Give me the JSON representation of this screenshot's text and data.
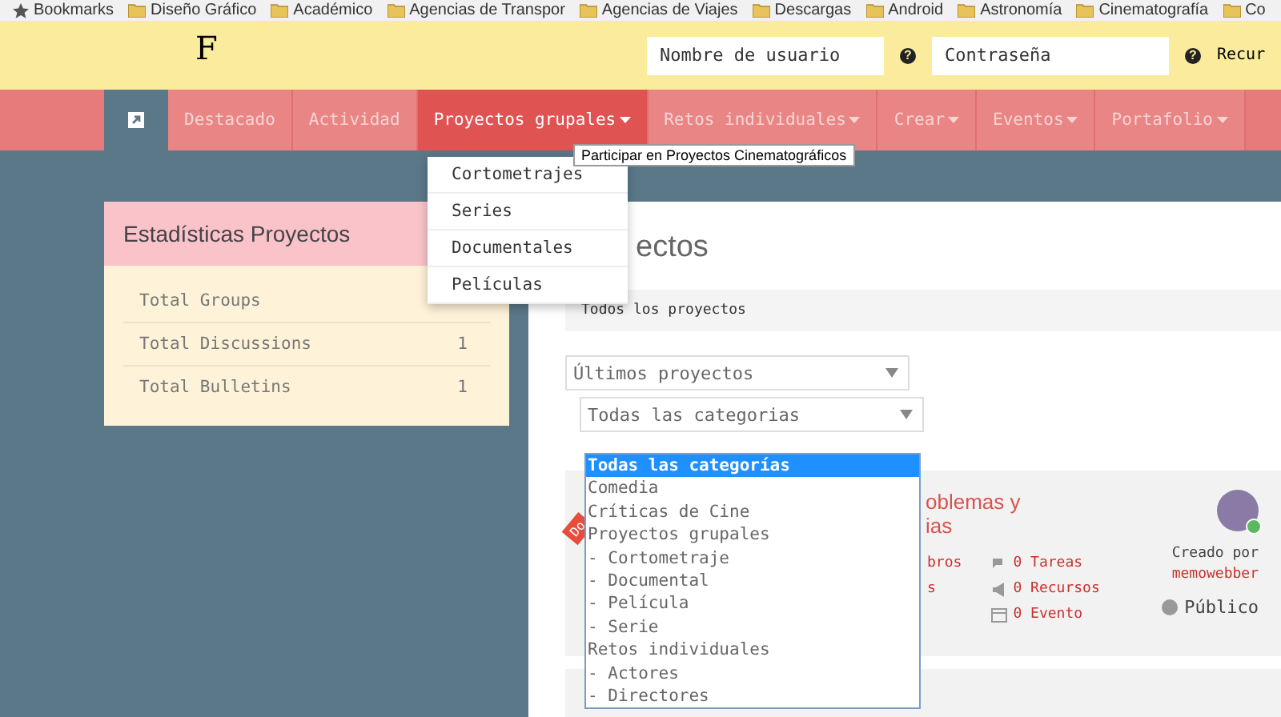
{
  "bookmarks_bar": {
    "items": [
      {
        "kind": "star",
        "label": "Bookmarks"
      },
      {
        "kind": "folder",
        "label": "Diseño Gráfico"
      },
      {
        "kind": "folder",
        "label": "Académico"
      },
      {
        "kind": "folder",
        "label": "Agencias de Transpor"
      },
      {
        "kind": "folder",
        "label": "Agencias de Viajes"
      },
      {
        "kind": "folder",
        "label": "Descargas"
      },
      {
        "kind": "folder",
        "label": "Android"
      },
      {
        "kind": "folder",
        "label": "Astronomía"
      },
      {
        "kind": "folder",
        "label": "Cinematografía"
      },
      {
        "kind": "folder",
        "label": "Co"
      }
    ]
  },
  "header": {
    "logo": "F",
    "username": {
      "placeholder": "Nombre de usuario",
      "help": "?"
    },
    "password": {
      "placeholder": "Contraseña",
      "help": "?"
    },
    "link": "Recur"
  },
  "nav": {
    "items": [
      {
        "label": "Destacado",
        "dropdown": false,
        "selected": false
      },
      {
        "label": "Actividad",
        "dropdown": false,
        "selected": false
      },
      {
        "label": "Proyectos grupales",
        "dropdown": true,
        "selected": true
      },
      {
        "label": "Retos individuales",
        "dropdown": true,
        "selected": false
      },
      {
        "label": "Crear",
        "dropdown": true,
        "selected": false
      },
      {
        "label": "Eventos",
        "dropdown": true,
        "selected": false
      },
      {
        "label": "Portafolio",
        "dropdown": true,
        "selected": false
      }
    ],
    "tooltip": "Participar en Proyectos Cinematográficos",
    "menu": [
      "Cortometrajes",
      "Series",
      "Documentales",
      "Películas"
    ]
  },
  "stats_card": {
    "title": "Estadísticas Proyectos",
    "rows": [
      {
        "label": "Total Groups"
      },
      {
        "label": "Total Discussions",
        "value": "1"
      },
      {
        "label": "Total Bulletins",
        "value": "1"
      }
    ]
  },
  "main": {
    "title": "ectos",
    "breadcrumb": "Todos los proyectos",
    "sort_select": "Últimos proyectos",
    "category_select": "Todas las categorias",
    "category_options": [
      {
        "label": "Todas las categorías",
        "selected": true
      },
      {
        "label": "Comedia",
        "selected": false
      },
      {
        "label": "Críticas de Cine",
        "selected": false
      },
      {
        "label": "Proyectos grupales",
        "selected": false
      },
      {
        "label": "- Cortometraje",
        "selected": false
      },
      {
        "label": "- Documental",
        "selected": false
      },
      {
        "label": "- Película",
        "selected": false
      },
      {
        "label": "- Serie",
        "selected": false
      },
      {
        "label": "Retos individuales",
        "selected": false
      },
      {
        "label": "- Actores",
        "selected": false
      },
      {
        "label": "- Directores",
        "selected": false
      }
    ],
    "project": {
      "ribbon": "Do",
      "title": "oblemas y\nias",
      "left_stats": [
        "bros",
        "s"
      ],
      "stats": [
        {
          "kind": "tasks",
          "label": "0 Tareas"
        },
        {
          "kind": "resources",
          "label": "0 Recursos"
        },
        {
          "kind": "event",
          "label": "0 Evento"
        }
      ],
      "created_by": "Creado por",
      "author": "memowebber",
      "visibility": "Público"
    }
  }
}
